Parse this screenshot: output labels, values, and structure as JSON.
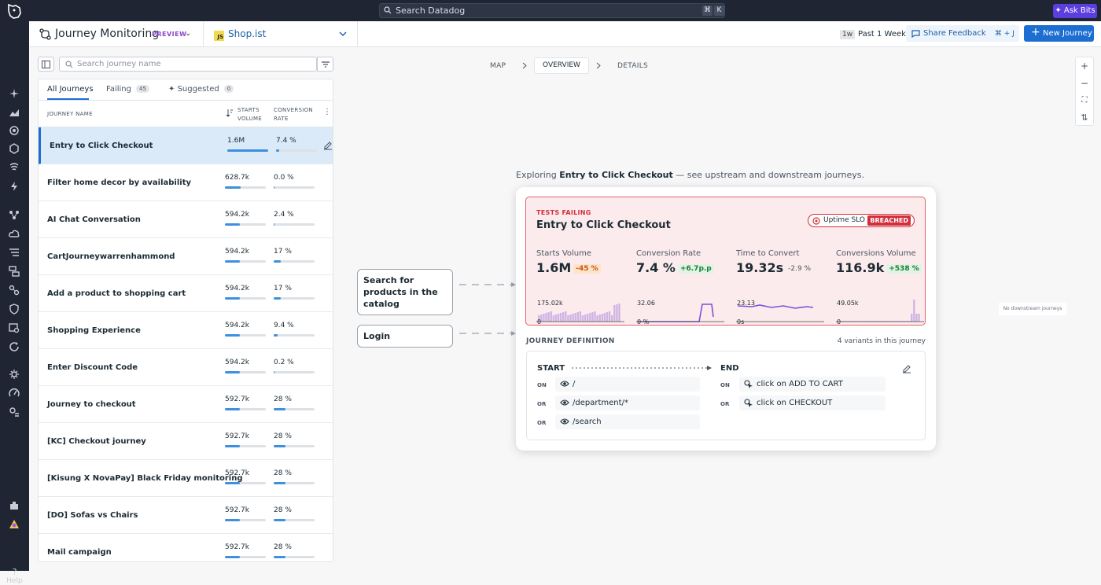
{
  "topbar": {
    "search_placeholder": "Search Datadog",
    "kbd1": "⌘",
    "kbd2": "K",
    "ask_bits": "Ask Bits"
  },
  "help_label": "Help",
  "header": {
    "title": "Journey Monitoring",
    "badge": "PREVIEW",
    "app": "Shop.ist",
    "range_tag": "1w",
    "range": "Past 1 Week",
    "share": "Share Feedback",
    "share_kbd": "⌘ + J",
    "new_journey": "New Journey"
  },
  "list": {
    "search_placeholder": "Search journey name",
    "tabs": [
      {
        "label": "All Journeys"
      },
      {
        "label": "Failing",
        "count": "45"
      },
      {
        "label": "Suggested",
        "count": "0"
      }
    ],
    "columns": {
      "name": "JOURNEY NAME",
      "starts_1": "STARTS",
      "starts_2": "VOLUME",
      "conv_1": "CONVERSION",
      "conv_2": "RATE"
    },
    "rows": [
      {
        "name": "Entry to Click Checkout",
        "volume": "1.6M",
        "vol_frac": 1.0,
        "conversion": "7.4 %",
        "conv_frac": 0.074
      },
      {
        "name": "Filter home decor by availability",
        "volume": "628.7k",
        "vol_frac": 0.39,
        "conversion": "0.0 %",
        "conv_frac": 0.0
      },
      {
        "name": "AI Chat Conversation",
        "volume": "594.2k",
        "vol_frac": 0.37,
        "conversion": "2.4 %",
        "conv_frac": 0.024
      },
      {
        "name": "CartJourneywarrenhammond",
        "volume": "594.2k",
        "vol_frac": 0.37,
        "conversion": "17 %",
        "conv_frac": 0.17
      },
      {
        "name": "Add a product to shopping cart",
        "volume": "594.2k",
        "vol_frac": 0.37,
        "conversion": "17 %",
        "conv_frac": 0.17
      },
      {
        "name": "Shopping Experience",
        "volume": "594.2k",
        "vol_frac": 0.37,
        "conversion": "9.4 %",
        "conv_frac": 0.094
      },
      {
        "name": "Enter Discount Code",
        "volume": "594.2k",
        "vol_frac": 0.37,
        "conversion": "0.2 %",
        "conv_frac": 0.002
      },
      {
        "name": "Journey to checkout",
        "volume": "592.7k",
        "vol_frac": 0.37,
        "conversion": "28 %",
        "conv_frac": 0.28
      },
      {
        "name": "[KC] Checkout journey",
        "volume": "592.7k",
        "vol_frac": 0.37,
        "conversion": "28 %",
        "conv_frac": 0.28
      },
      {
        "name": "[Kisung X NovaPay] Black Friday monitoring",
        "volume": "592.7k",
        "vol_frac": 0.37,
        "conversion": "28 %",
        "conv_frac": 0.28
      },
      {
        "name": "[DO] Sofas vs Chairs",
        "volume": "592.7k",
        "vol_frac": 0.37,
        "conversion": "28 %",
        "conv_frac": 0.28
      },
      {
        "name": "Mail campaign",
        "volume": "592.7k",
        "vol_frac": 0.37,
        "conversion": "28 %",
        "conv_frac": 0.28
      }
    ]
  },
  "canvas": {
    "tabs": [
      "MAP",
      "OVERVIEW",
      "DETAILS"
    ],
    "explore_pre": "Exploring",
    "explore_name": "Entry to Click Checkout",
    "explore_post": "— see upstream and downstream journeys.",
    "upstream": [
      "Search for products in the catalog",
      "Login"
    ],
    "no_downstream": "No downstream journeys"
  },
  "card": {
    "status": "TESTS FAILING",
    "title": "Entry to Click Checkout",
    "slo_label": "Uptime SLO",
    "slo_status": "BREACHED",
    "metrics": [
      {
        "label": "Starts Volume",
        "value": "1.6M",
        "delta": "-45 %",
        "delta_type": "neg",
        "chart_max": "175.02k",
        "chart_min": "0"
      },
      {
        "label": "Conversion Rate",
        "value": "7.4 %",
        "delta": "+6.7p.p",
        "delta_type": "pos",
        "chart_max": "32.06",
        "chart_min": "0 %"
      },
      {
        "label": "Time to Convert",
        "value": "19.32s",
        "delta": "-2.9 %",
        "delta_type": "plain",
        "chart_max": "23.13",
        "chart_min": "0s"
      },
      {
        "label": "Conversions Volume",
        "value": "116.9k",
        "delta": "+538 %",
        "delta_type": "pos",
        "chart_max": "49.05k",
        "chart_min": "0"
      }
    ],
    "definition_label": "JOURNEY DEFINITION",
    "variants": "4 variants in this journey",
    "start_label": "START",
    "end_label": "END",
    "start_steps": [
      {
        "cond": "ON",
        "value": "/"
      },
      {
        "cond": "OR",
        "value": "/department/*"
      },
      {
        "cond": "OR",
        "value": "/search"
      }
    ],
    "end_steps": [
      {
        "cond": "ON",
        "value": "click on ADD TO CART"
      },
      {
        "cond": "OR",
        "value": "click on CHECKOUT"
      }
    ]
  },
  "colors": {
    "accent": "#1c6fd1",
    "fail": "#d12f3b",
    "topbar": "#1f2532",
    "chart": "#7b4fd6"
  }
}
